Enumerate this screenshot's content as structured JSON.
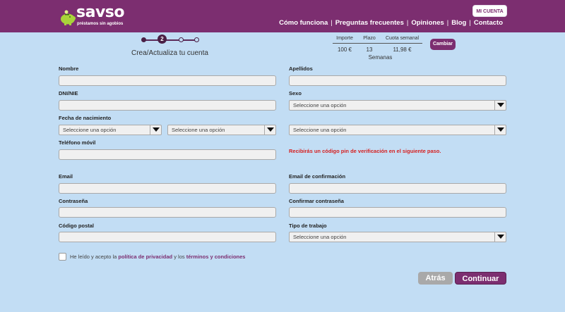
{
  "header": {
    "logo_text": "savso",
    "logo_tagline": "préstamos sin agobios",
    "account_button": "MI CUENTA",
    "nav": [
      "Cómo funciona",
      "Preguntas frecuentes",
      "Opiniones",
      "Blog",
      "Contacto"
    ],
    "nav_separator": "|"
  },
  "stepper": {
    "current_step": "2",
    "title": "Crea/Actualiza tu cuenta"
  },
  "summary": {
    "headers": [
      "Importe",
      "Plazo",
      "Cuota semanal"
    ],
    "amount": "100 €",
    "term": "13",
    "term_unit": "Semanas",
    "weekly_fee": "11,98 €",
    "change_button": "Cambiar"
  },
  "form": {
    "nombre_label": "Nombre",
    "nombre_value": "",
    "apellidos_label": "Apellidos",
    "apellidos_value": "",
    "dni_label": "DNI/NIE",
    "dni_value": "",
    "sexo_label": "Sexo",
    "sexo_value": "Seleccione una opción",
    "fecha_label": "Fecha de nacimiento",
    "day_value": "Seleccione una opción",
    "month_value": "Seleccione una opción",
    "year_value": "Seleccione una opción",
    "telefono_label": "Teléfono móvil",
    "telefono_value": "",
    "pin_notice": "Recibirás un código pin de verificación en el siguiente paso.",
    "email_label": "Email",
    "email_value": "",
    "email_confirm_label": "Email de confirmación",
    "email_confirm_value": "",
    "password_label": "Contraseña",
    "password_value": "",
    "password_confirm_label": "Confirmar contraseña",
    "password_confirm_value": "",
    "postal_label": "Código postal",
    "postal_value": "",
    "trabajo_label": "Tipo de trabajo",
    "trabajo_value": "Seleccione una opción"
  },
  "consent": {
    "prefix": "He leído y acepto la",
    "privacy_link": "política de privacidad",
    "middle": "y los",
    "terms_link": "términos y condiciones",
    "checked": false
  },
  "actions": {
    "back": "Atrás",
    "continue": "Continuar"
  },
  "colors": {
    "brand": "#7c2e70",
    "background": "#c2ddf4",
    "notice": "#d62020",
    "logo_green": "#a9d33a"
  },
  "icons": [
    "piggy-bank-icon",
    "contact-card-icon",
    "eye-icon",
    "chevron-down-icon"
  ]
}
